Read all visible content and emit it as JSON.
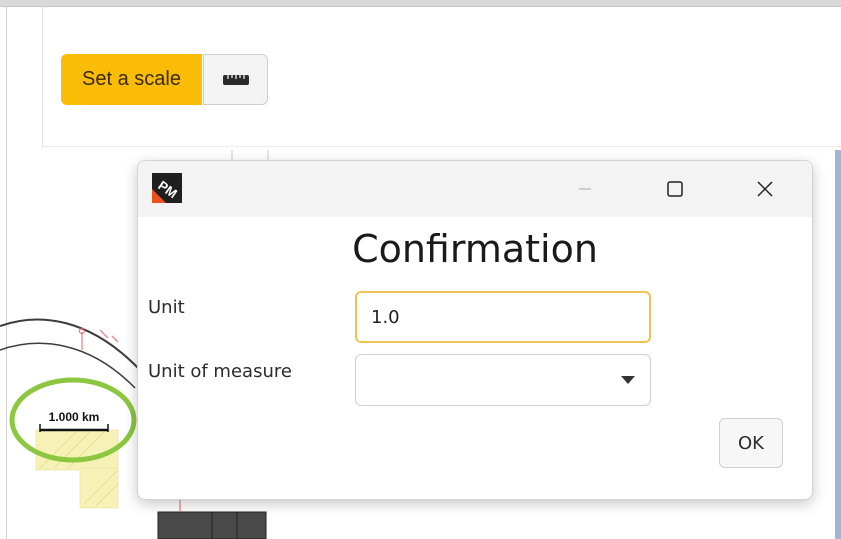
{
  "toolbar": {
    "set_scale_label": "Set a scale",
    "ruler_icon": "ruler-icon",
    "accent_color": "#fbbc05"
  },
  "map": {
    "scale_bar_label": "1.000 km",
    "highlight_color": "#8dc63f"
  },
  "dialog": {
    "app_logo_text": "PM",
    "title": "Confirmation",
    "unit_label": "Unit",
    "unit_value": "1.0",
    "unit_of_measure_label": "Unit of measure",
    "unit_of_measure_value": "",
    "ok_label": "OK",
    "controls": [
      "minimize-icon",
      "maximize-icon",
      "close-icon"
    ]
  }
}
